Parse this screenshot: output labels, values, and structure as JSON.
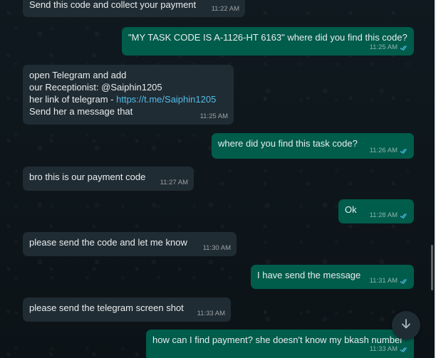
{
  "messages": [
    {
      "dir": "in",
      "text": "Send this code and collect your payment",
      "time": "11:22 AM"
    },
    {
      "dir": "out",
      "text": "\"MY TASK CODE IS A-1126-HT 6163\" where did you find this code?",
      "time": "11:25 AM"
    },
    {
      "dir": "in",
      "line1": "open Telegram and add",
      "line2": "our Receptionist: @Saiphin1205",
      "line3_prefix": "her link of telegram - ",
      "link": "https://t.me/Saiphin1205",
      "line4": "Send her a message that",
      "time": "11:25 AM"
    },
    {
      "dir": "out",
      "text": "where did you find this task code?",
      "time": "11:26 AM"
    },
    {
      "dir": "in",
      "text": "bro this is our payment code",
      "time": "11:27 AM"
    },
    {
      "dir": "out",
      "text": "Ok",
      "time": "11:28 AM"
    },
    {
      "dir": "in",
      "text": "please send the code and let me know",
      "time": "11:30 AM"
    },
    {
      "dir": "out",
      "text": "I have send the message",
      "time": "11:31 AM"
    },
    {
      "dir": "in",
      "text": "please send the telegram screen shot",
      "time": "11:33 AM"
    },
    {
      "dir": "out",
      "text": "how can I find payment? she doesn't know my bkash number",
      "time": "11:33 AM"
    }
  ],
  "icons": {
    "read_receipt": "double-check-icon",
    "scroll_down": "arrow-down-icon"
  },
  "colors": {
    "incoming_bubble": "#202c33",
    "outgoing_bubble": "#005c4b",
    "link": "#53bdeb",
    "read_tick": "#53bdeb"
  }
}
